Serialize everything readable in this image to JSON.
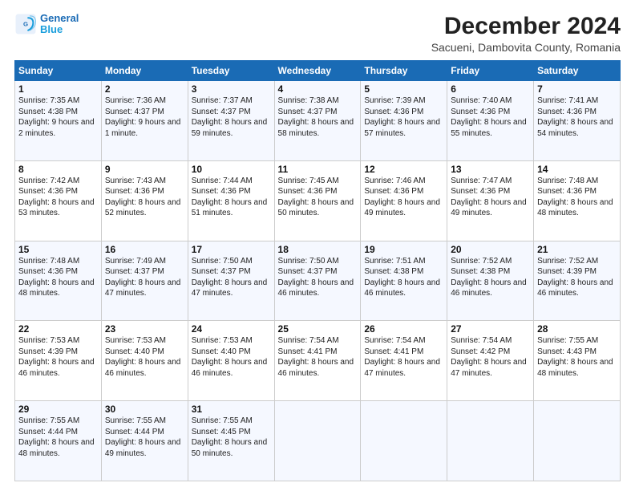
{
  "logo": {
    "line1": "General",
    "line2": "Blue"
  },
  "title": "December 2024",
  "subtitle": "Sacueni, Dambovita County, Romania",
  "weekdays": [
    "Sunday",
    "Monday",
    "Tuesday",
    "Wednesday",
    "Thursday",
    "Friday",
    "Saturday"
  ],
  "weeks": [
    [
      {
        "day": 1,
        "rise": "7:35 AM",
        "set": "4:38 PM",
        "daylight": "9 hours and 2 minutes."
      },
      {
        "day": 2,
        "rise": "7:36 AM",
        "set": "4:37 PM",
        "daylight": "9 hours and 1 minute."
      },
      {
        "day": 3,
        "rise": "7:37 AM",
        "set": "4:37 PM",
        "daylight": "8 hours and 59 minutes."
      },
      {
        "day": 4,
        "rise": "7:38 AM",
        "set": "4:37 PM",
        "daylight": "8 hours and 58 minutes."
      },
      {
        "day": 5,
        "rise": "7:39 AM",
        "set": "4:36 PM",
        "daylight": "8 hours and 57 minutes."
      },
      {
        "day": 6,
        "rise": "7:40 AM",
        "set": "4:36 PM",
        "daylight": "8 hours and 55 minutes."
      },
      {
        "day": 7,
        "rise": "7:41 AM",
        "set": "4:36 PM",
        "daylight": "8 hours and 54 minutes."
      }
    ],
    [
      {
        "day": 8,
        "rise": "7:42 AM",
        "set": "4:36 PM",
        "daylight": "8 hours and 53 minutes."
      },
      {
        "day": 9,
        "rise": "7:43 AM",
        "set": "4:36 PM",
        "daylight": "8 hours and 52 minutes."
      },
      {
        "day": 10,
        "rise": "7:44 AM",
        "set": "4:36 PM",
        "daylight": "8 hours and 51 minutes."
      },
      {
        "day": 11,
        "rise": "7:45 AM",
        "set": "4:36 PM",
        "daylight": "8 hours and 50 minutes."
      },
      {
        "day": 12,
        "rise": "7:46 AM",
        "set": "4:36 PM",
        "daylight": "8 hours and 49 minutes."
      },
      {
        "day": 13,
        "rise": "7:47 AM",
        "set": "4:36 PM",
        "daylight": "8 hours and 49 minutes."
      },
      {
        "day": 14,
        "rise": "7:48 AM",
        "set": "4:36 PM",
        "daylight": "8 hours and 48 minutes."
      }
    ],
    [
      {
        "day": 15,
        "rise": "7:48 AM",
        "set": "4:36 PM",
        "daylight": "8 hours and 48 minutes."
      },
      {
        "day": 16,
        "rise": "7:49 AM",
        "set": "4:37 PM",
        "daylight": "8 hours and 47 minutes."
      },
      {
        "day": 17,
        "rise": "7:50 AM",
        "set": "4:37 PM",
        "daylight": "8 hours and 47 minutes."
      },
      {
        "day": 18,
        "rise": "7:50 AM",
        "set": "4:37 PM",
        "daylight": "8 hours and 46 minutes."
      },
      {
        "day": 19,
        "rise": "7:51 AM",
        "set": "4:38 PM",
        "daylight": "8 hours and 46 minutes."
      },
      {
        "day": 20,
        "rise": "7:52 AM",
        "set": "4:38 PM",
        "daylight": "8 hours and 46 minutes."
      },
      {
        "day": 21,
        "rise": "7:52 AM",
        "set": "4:39 PM",
        "daylight": "8 hours and 46 minutes."
      }
    ],
    [
      {
        "day": 22,
        "rise": "7:53 AM",
        "set": "4:39 PM",
        "daylight": "8 hours and 46 minutes."
      },
      {
        "day": 23,
        "rise": "7:53 AM",
        "set": "4:40 PM",
        "daylight": "8 hours and 46 minutes."
      },
      {
        "day": 24,
        "rise": "7:53 AM",
        "set": "4:40 PM",
        "daylight": "8 hours and 46 minutes."
      },
      {
        "day": 25,
        "rise": "7:54 AM",
        "set": "4:41 PM",
        "daylight": "8 hours and 46 minutes."
      },
      {
        "day": 26,
        "rise": "7:54 AM",
        "set": "4:41 PM",
        "daylight": "8 hours and 47 minutes."
      },
      {
        "day": 27,
        "rise": "7:54 AM",
        "set": "4:42 PM",
        "daylight": "8 hours and 47 minutes."
      },
      {
        "day": 28,
        "rise": "7:55 AM",
        "set": "4:43 PM",
        "daylight": "8 hours and 48 minutes."
      }
    ],
    [
      {
        "day": 29,
        "rise": "7:55 AM",
        "set": "4:44 PM",
        "daylight": "8 hours and 48 minutes."
      },
      {
        "day": 30,
        "rise": "7:55 AM",
        "set": "4:44 PM",
        "daylight": "8 hours and 49 minutes."
      },
      {
        "day": 31,
        "rise": "7:55 AM",
        "set": "4:45 PM",
        "daylight": "8 hours and 50 minutes."
      },
      null,
      null,
      null,
      null
    ]
  ]
}
